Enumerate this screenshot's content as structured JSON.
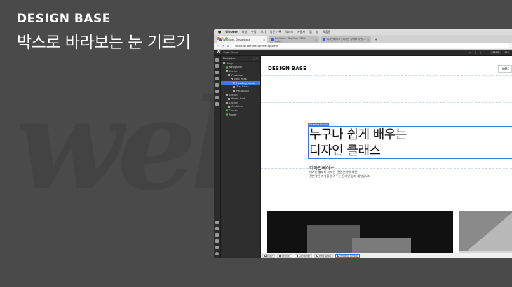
{
  "slide": {
    "brand": "DESIGN BASE",
    "title": "박스로 바라보는 눈 기르기",
    "watermark": "web"
  },
  "mac_menubar": {
    "apple": "",
    "app": "Chrome",
    "items": [
      "파일",
      "수정",
      "보기",
      "방문 기록",
      "북마크",
      "사용자",
      "탭",
      "창",
      "도움말"
    ]
  },
  "browser": {
    "tabs": [
      {
        "label": "Webflow - Designbase",
        "active": true
      },
      {
        "label": "Portfolio - Webflow HTML web...",
        "active": false
      },
      {
        "label": "디자인베이스 | 디자인 강좌와 이벤...",
        "active": false
      }
    ],
    "new_tab": "+",
    "url": "webflow.com/design/designbase",
    "nav_back": "←",
    "nav_forward": "→",
    "nav_reload": "⟳"
  },
  "webflow_top": {
    "logo": "W",
    "page_label": "Page: Home",
    "size": "1473",
    "zoom": "100"
  },
  "navigator": {
    "title": "Navigator",
    "items": [
      {
        "label": "Body",
        "indent": 0,
        "selected": false,
        "green": false
      },
      {
        "label": "Navigation",
        "indent": 1,
        "selected": false,
        "green": true
      },
      {
        "label": "Section",
        "indent": 1,
        "selected": false,
        "green": false
      },
      {
        "label": "Container",
        "indent": 2,
        "selected": false,
        "green": false
      },
      {
        "label": "Intro Wrap",
        "indent": 3,
        "selected": false,
        "green": false
      },
      {
        "label": "Heading Jumbo",
        "indent": 4,
        "selected": true,
        "green": false
      },
      {
        "label": "Text Block",
        "indent": 4,
        "selected": false,
        "green": false
      },
      {
        "label": "Paragraph",
        "indent": 4,
        "selected": false,
        "green": false
      },
      {
        "label": "Section",
        "indent": 1,
        "selected": false,
        "green": false
      },
      {
        "label": "Works Grid",
        "indent": 2,
        "selected": false,
        "green": false
      },
      {
        "label": "Section",
        "indent": 1,
        "selected": false,
        "green": false
      },
      {
        "label": "Container",
        "indent": 2,
        "selected": false,
        "green": false
      },
      {
        "label": "Contact",
        "indent": 1,
        "selected": false,
        "green": true
      },
      {
        "label": "Footer",
        "indent": 1,
        "selected": false,
        "green": true
      }
    ]
  },
  "site": {
    "logo": "DESIGN BASE",
    "nav_home": "HOME",
    "selected_label": "Heading Jumbo",
    "heading_line1": "누구나 쉽게 배우는",
    "heading_line2": "디자인 클래스",
    "subheading": "디자인베이스",
    "paragraph_line1": "디자인 툴부터 디자인 전문 분야에 대한",
    "paragraph_line2": "전반적인 지식을 알려주는 온라인 강좌 채널입니다"
  },
  "breadcrumbs": [
    "Body",
    "Section",
    "Container",
    "Intro Wrap",
    "Heading Jumbo"
  ],
  "colors": {
    "selection": "#3d79e0",
    "editor_dark": "#2e2e2e",
    "slide_bg": "#4a4a4a"
  }
}
